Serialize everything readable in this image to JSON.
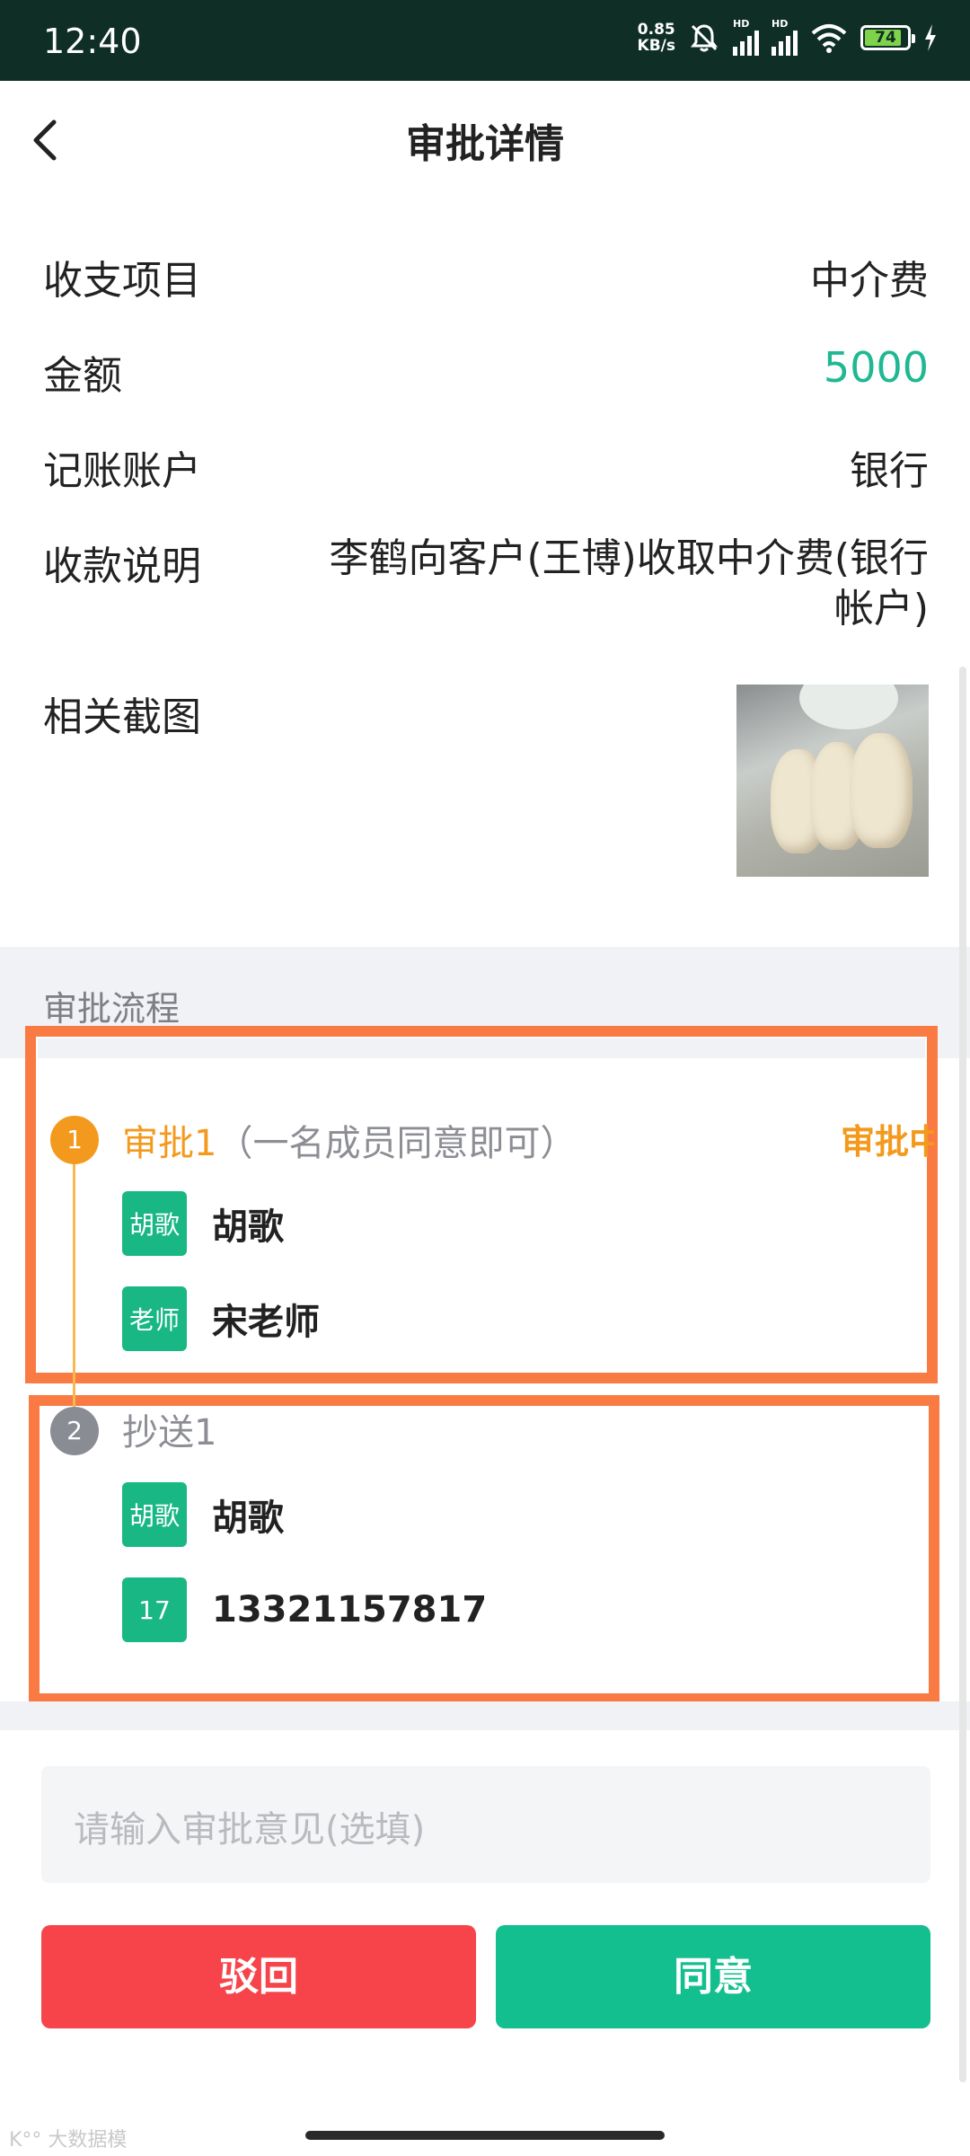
{
  "status_bar": {
    "time": "12:40",
    "net_speed_value": "0.85",
    "net_speed_unit": "KB/s",
    "hd1": "HD",
    "hd2": "HD",
    "battery": "74"
  },
  "header": {
    "title": "审批详情"
  },
  "details": {
    "item_label": "收支项目",
    "item_value": "中介费",
    "amount_label": "金额",
    "amount_value": "5000",
    "account_label": "记账账户",
    "account_value": "银行",
    "desc_label": "收款说明",
    "desc_value": "李鹤向客户(王博)收取中介费(银行帐户)",
    "screenshot_label": "相关截图"
  },
  "flow": {
    "section_title": "审批流程",
    "step1": {
      "number": "1",
      "title": "审批1",
      "note": "（一名成员同意即可）",
      "status": "审批中",
      "members": [
        {
          "avatar": "胡歌",
          "name": "胡歌"
        },
        {
          "avatar": "老师",
          "name": "宋老师"
        }
      ]
    },
    "step2": {
      "number": "2",
      "title": "抄送1",
      "members": [
        {
          "avatar": "胡歌",
          "name": "胡歌"
        },
        {
          "avatar": "17",
          "name": "13321157817"
        }
      ]
    }
  },
  "opinion": {
    "placeholder": "请输入审批意见(选填)"
  },
  "actions": {
    "reject": "驳回",
    "approve": "同意"
  },
  "watermark": "K°° 大数据模",
  "colors": {
    "status_bar": "#0f2e26",
    "amount": "#1fb892",
    "step_active": "#f39a1e",
    "avatar": "#18b784",
    "reject": "#f6444a",
    "approve": "#13bf8e",
    "highlight": "#fa7a44"
  },
  "icons": [
    "back-icon",
    "mute-icon",
    "wifi-icon",
    "charging-icon"
  ]
}
